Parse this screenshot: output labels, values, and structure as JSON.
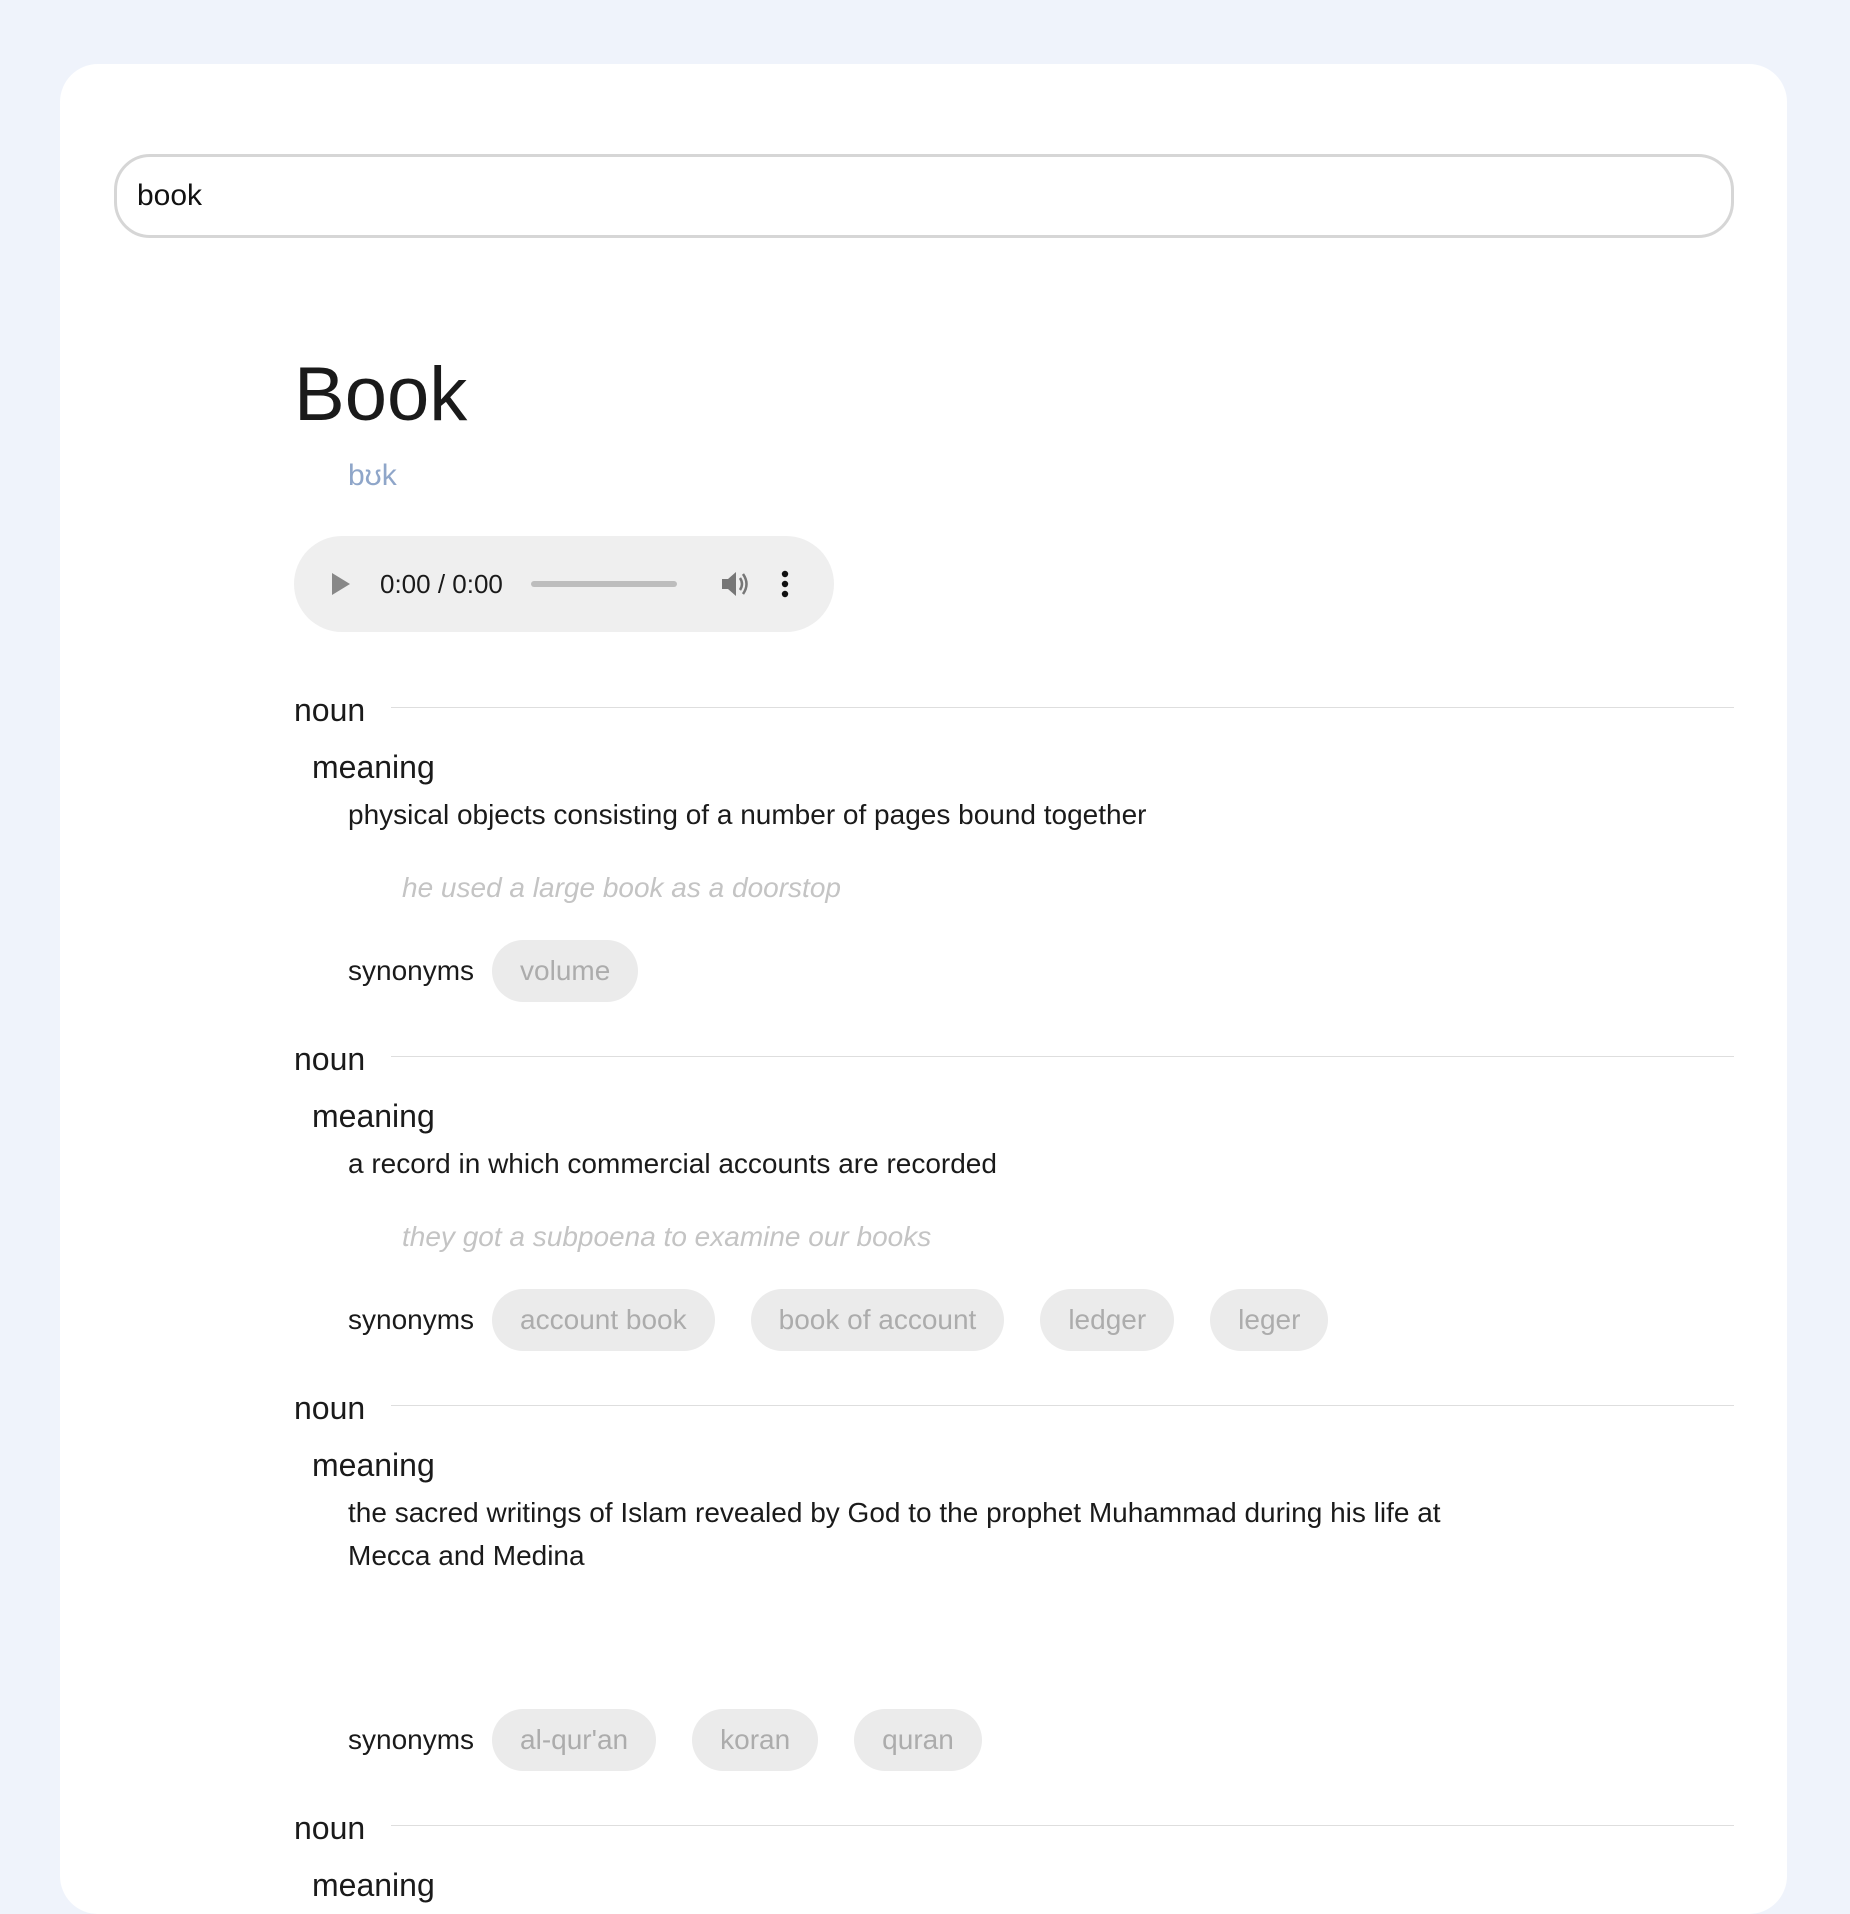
{
  "search": {
    "value": "book"
  },
  "entry": {
    "word": "Book",
    "phonetic": "bʊk",
    "audio": {
      "time": "0:00 / 0:00"
    }
  },
  "labels": {
    "meaning": "meaning",
    "synonyms": "synonyms"
  },
  "senses": [
    {
      "pos": "noun",
      "definition": "physical objects consisting of a number of pages bound together",
      "example": "he used a large book as a doorstop",
      "synonyms": [
        "volume"
      ]
    },
    {
      "pos": "noun",
      "definition": "a record in which commercial accounts are recorded",
      "example": "they got a subpoena to examine our books",
      "synonyms": [
        "account book",
        "book of account",
        "ledger",
        "leger"
      ]
    },
    {
      "pos": "noun",
      "definition": "the sacred writings of Islam revealed by God to the prophet Muhammad during his life at Mecca and Medina",
      "example": "",
      "synonyms": [
        "al-qur'an",
        "koran",
        "quran"
      ]
    },
    {
      "pos": "noun"
    }
  ]
}
